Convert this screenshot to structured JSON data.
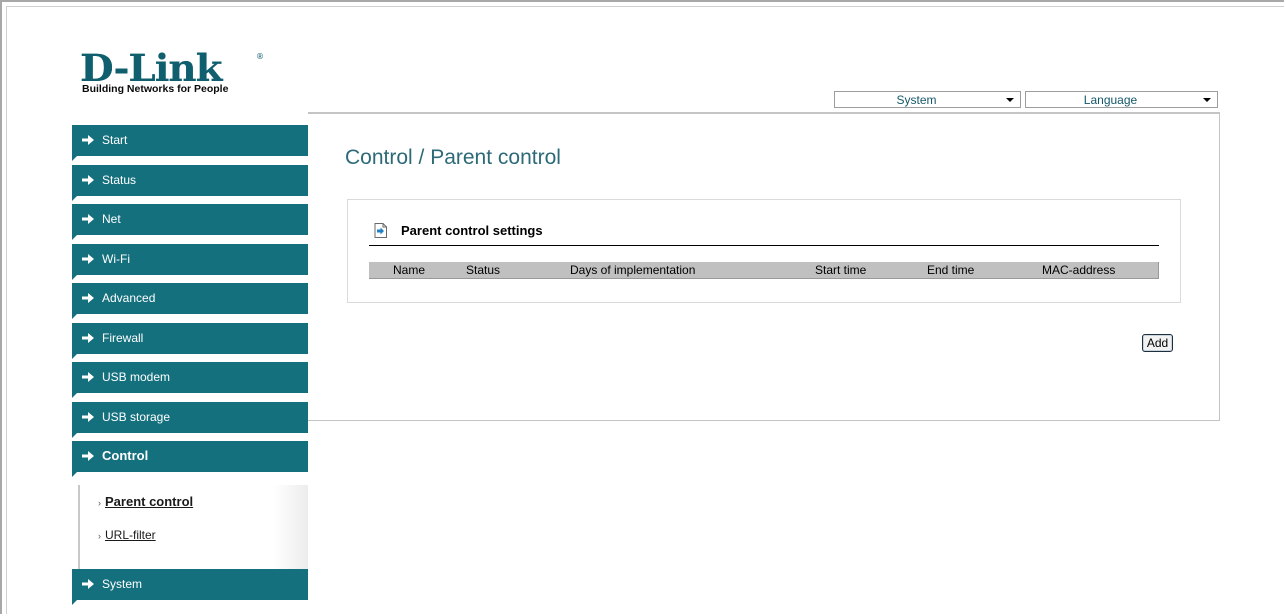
{
  "logo": {
    "brand": "D-Link",
    "registered": "®",
    "tagline": "Building Networks for People"
  },
  "topbar": {
    "system_select": "System",
    "language_select": "Language"
  },
  "sidebar": {
    "items": [
      {
        "label": "Start",
        "active": false
      },
      {
        "label": "Status",
        "active": false
      },
      {
        "label": "Net",
        "active": false
      },
      {
        "label": "Wi-Fi",
        "active": false
      },
      {
        "label": "Advanced",
        "active": false
      },
      {
        "label": "Firewall",
        "active": false
      },
      {
        "label": "USB modem",
        "active": false
      },
      {
        "label": "USB storage",
        "active": false
      },
      {
        "label": "Control",
        "active": true
      },
      {
        "label": "System",
        "active": false
      }
    ],
    "submenu": [
      {
        "label": "Parent control",
        "active": true
      },
      {
        "label": "URL-filter",
        "active": false
      }
    ]
  },
  "main": {
    "page_title": "Control / Parent control",
    "section_title": "Parent control settings",
    "table_headers": [
      "Name",
      "Status",
      "Days of implementation",
      "Start time",
      "End time",
      "MAC-address"
    ],
    "add_button": "Add"
  },
  "colors": {
    "nav_bg": "#15707e",
    "title": "#2d6a78",
    "logo": "#0f5f6e"
  }
}
